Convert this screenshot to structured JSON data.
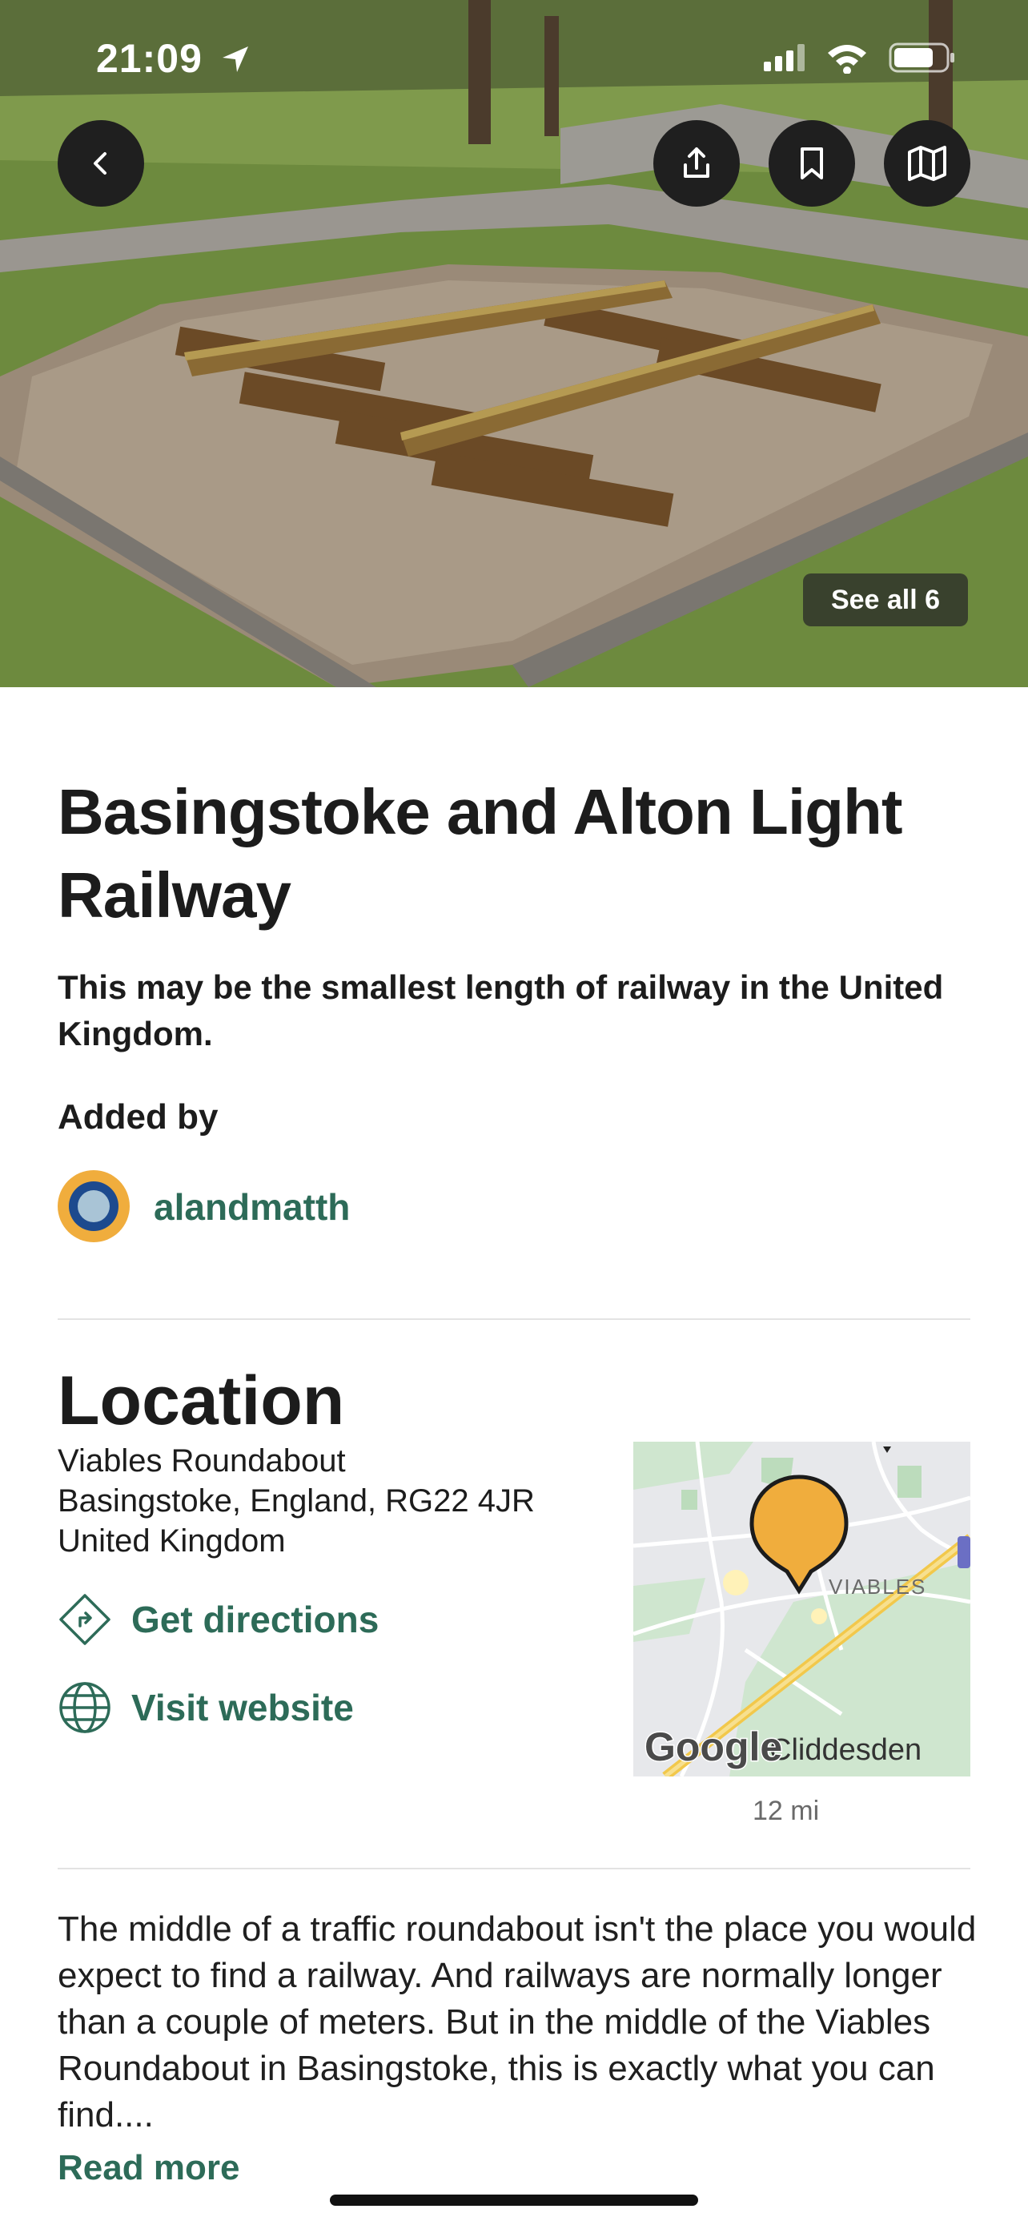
{
  "status_bar": {
    "time": "21:09",
    "icons": [
      "location-arrow-icon",
      "cellular-signal-icon",
      "wifi-icon",
      "battery-icon"
    ]
  },
  "hero": {
    "buttons": [
      "back-icon",
      "share-icon",
      "bookmark-icon",
      "map-icon"
    ],
    "see_all_label": "See all 6"
  },
  "place": {
    "title": "Basingstoke and Alton Light Railway",
    "subtitle": "This may be the smallest length of railway in the United Kingdom."
  },
  "added_by": {
    "label": "Added by",
    "username": "alandmatth"
  },
  "location": {
    "heading": "Location",
    "address_line1": "Viables Roundabout",
    "address_line2": "Basingstoke, England, RG22 4JR",
    "address_line3": "United Kingdom",
    "directions_label": "Get directions",
    "website_label": "Visit website",
    "map_label_area": "VIABLES",
    "map_label_town": "Cliddesden",
    "map_brand": "Google",
    "distance": "12 mi"
  },
  "description": {
    "text": "The middle of a traffic roundabout isn't the place you would expect to find a railway. And railways are normally longer than a couple of meters. But in the middle of the Viables Roundabout in Basingstoke, this is exactly what you can find....",
    "read_more_label": "Read more"
  },
  "colors": {
    "accent_green": "#2d6b58",
    "marker_orange": "#f0ad3d",
    "button_dark": "#1f1f1f"
  }
}
